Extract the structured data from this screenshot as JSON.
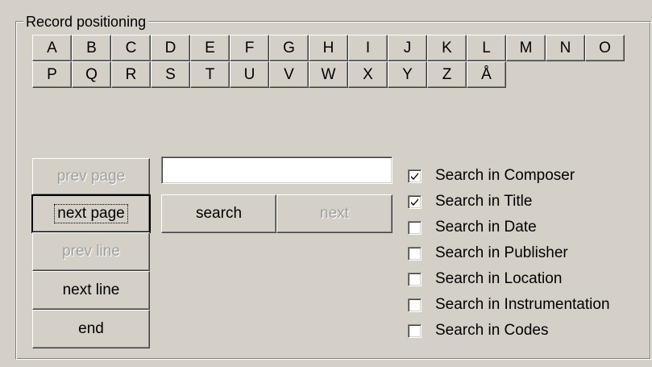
{
  "group": {
    "title": "Record positioning"
  },
  "letters_row1": [
    "A",
    "B",
    "C",
    "D",
    "E",
    "F",
    "G",
    "H",
    "I",
    "J",
    "K",
    "L",
    "M",
    "N",
    "O"
  ],
  "letters_row2": [
    "P",
    "Q",
    "R",
    "S",
    "T",
    "U",
    "V",
    "W",
    "X",
    "Y",
    "Z",
    "Å"
  ],
  "nav": {
    "prev_page": "prev page",
    "next_page": "next page",
    "prev_line": "prev line",
    "next_line": "next line",
    "end": "end"
  },
  "search": {
    "value": "",
    "search_label": "search",
    "next_label": "next"
  },
  "options": [
    {
      "label": "Search in Composer",
      "checked": true
    },
    {
      "label": "Search in Title",
      "checked": true
    },
    {
      "label": "Search in Date",
      "checked": false
    },
    {
      "label": "Search in Publisher",
      "checked": false
    },
    {
      "label": "Search in Location",
      "checked": false
    },
    {
      "label": "Search in Instrumentation",
      "checked": false
    },
    {
      "label": "Search in Codes",
      "checked": false
    }
  ]
}
